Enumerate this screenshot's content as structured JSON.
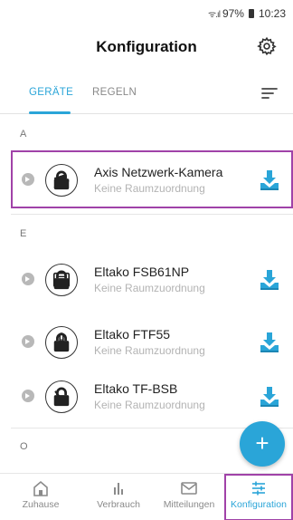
{
  "status_bar": {
    "battery": "97%",
    "time": "10:23"
  },
  "header": {
    "title": "Konfiguration"
  },
  "tabs": [
    {
      "label": "GERÄTE"
    },
    {
      "label": "REGELN"
    }
  ],
  "sections": [
    {
      "letter": "A"
    },
    {
      "letter": "E"
    },
    {
      "letter": "O"
    }
  ],
  "devices": [
    {
      "name": "Axis Netzwerk-Kamera",
      "room": "Keine Raumzuordnung",
      "icon": "camera-icon"
    },
    {
      "name": "Eltako FSB61NP",
      "room": "Keine Raumzuordnung",
      "icon": "blind-icon"
    },
    {
      "name": "Eltako FTF55",
      "room": "Keine Raumzuordnung",
      "icon": "thermometer-icon"
    },
    {
      "name": "Eltako TF-BSB",
      "room": "Keine Raumzuordnung",
      "icon": "switch-icon"
    }
  ],
  "fab": {
    "label": "+"
  },
  "bottom_nav": [
    {
      "label": "Zuhause"
    },
    {
      "label": "Verbrauch"
    },
    {
      "label": "Mitteilungen"
    },
    {
      "label": "Konfiguration"
    }
  ],
  "colors": {
    "accent": "#2aa5d8",
    "highlight": "#a042a8"
  }
}
